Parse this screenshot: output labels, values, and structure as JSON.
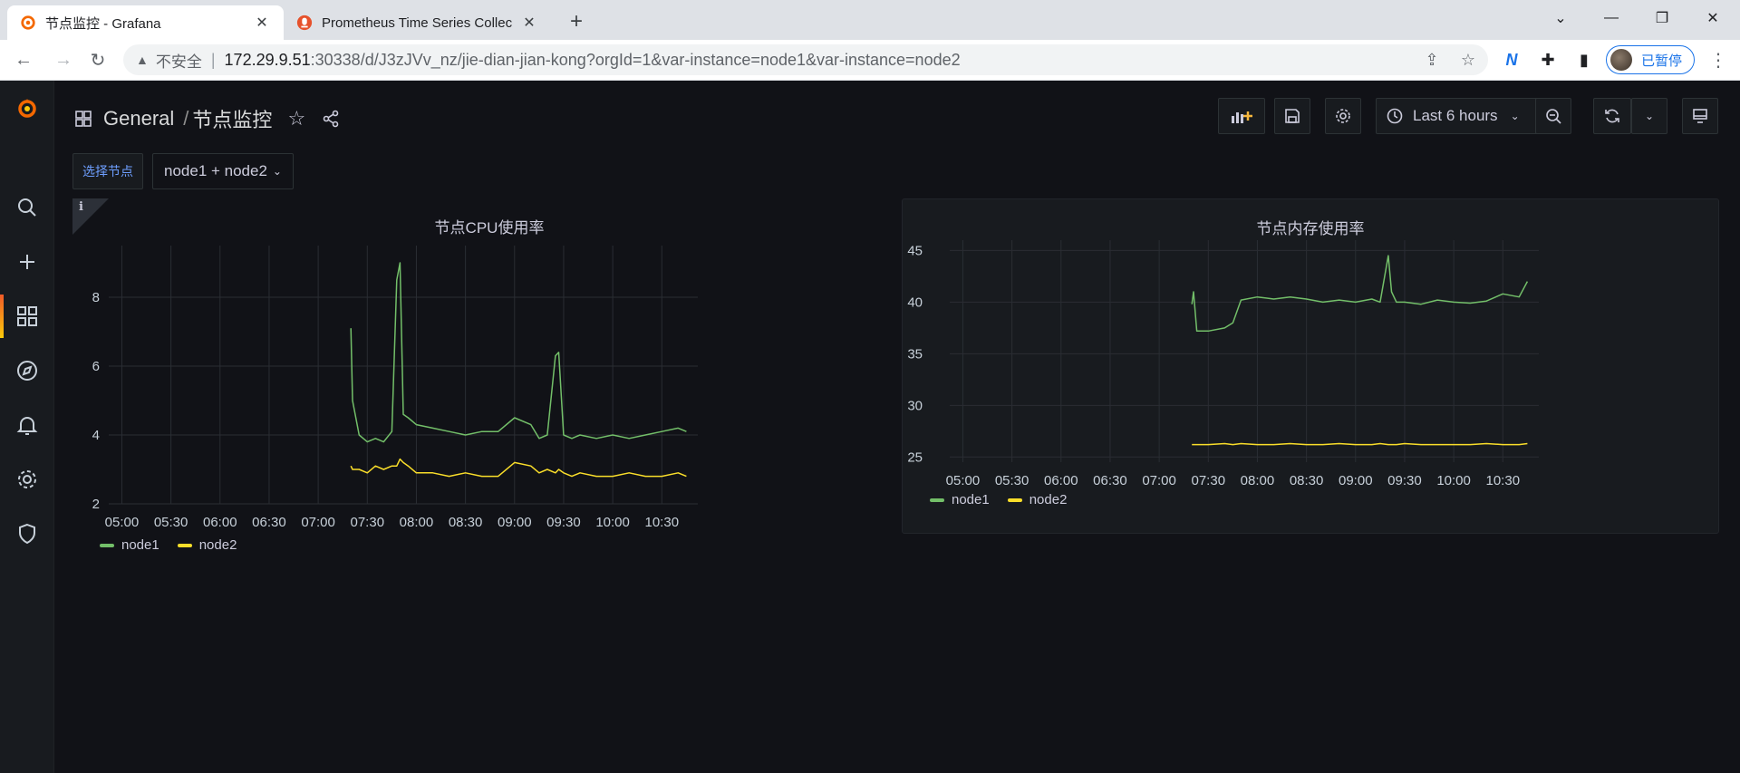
{
  "browser": {
    "tabs": [
      {
        "title": "节点监控 - Grafana",
        "active": true
      },
      {
        "title": "Prometheus Time Series Collec",
        "active": false
      }
    ],
    "address": {
      "insecure_label": "不安全",
      "host": "172.29.9.51",
      "path": ":30338/d/J3zJVv_nz/jie-dian-jian-kong?orgId=1&var-instance=node1&var-instance=node2"
    },
    "profile_label": "已暂停"
  },
  "dashboard": {
    "folder": "General",
    "title": "节点监控",
    "time_range": "Last 6 hours",
    "variable": {
      "label": "选择节点",
      "value": "node1 + node2"
    }
  },
  "colors": {
    "node1": "#73bf69",
    "node2": "#fade2a",
    "grid": "#2a2d33"
  },
  "chart_data": [
    {
      "type": "line",
      "title": "节点CPU使用率",
      "xlabel": "",
      "ylabel": "",
      "x_ticks": [
        "05:00",
        "05:30",
        "06:00",
        "06:30",
        "07:00",
        "07:30",
        "08:00",
        "08:30",
        "09:00",
        "09:30",
        "10:00",
        "10:30"
      ],
      "y_ticks": [
        "2",
        "4",
        "6",
        "8"
      ],
      "ylim": [
        2,
        9.5
      ],
      "x": [
        "07:20",
        "07:21",
        "07:25",
        "07:30",
        "07:35",
        "07:40",
        "07:45",
        "07:48",
        "07:50",
        "07:52",
        "07:55",
        "08:00",
        "08:10",
        "08:20",
        "08:30",
        "08:40",
        "08:50",
        "09:00",
        "09:10",
        "09:15",
        "09:20",
        "09:25",
        "09:27",
        "09:30",
        "09:35",
        "09:40",
        "09:50",
        "10:00",
        "10:10",
        "10:20",
        "10:30",
        "10:40",
        "10:45"
      ],
      "series": [
        {
          "name": "node1",
          "values": [
            7.1,
            5.0,
            4.0,
            3.8,
            3.9,
            3.8,
            4.1,
            8.5,
            9.0,
            4.6,
            4.5,
            4.3,
            4.2,
            4.1,
            4.0,
            4.1,
            4.1,
            4.5,
            4.3,
            3.9,
            4.0,
            6.3,
            6.4,
            4.0,
            3.9,
            4.0,
            3.9,
            4.0,
            3.9,
            4.0,
            4.1,
            4.2,
            4.1
          ]
        },
        {
          "name": "node2",
          "values": [
            3.1,
            3.0,
            3.0,
            2.9,
            3.1,
            3.0,
            3.1,
            3.1,
            3.3,
            3.2,
            3.1,
            2.9,
            2.9,
            2.8,
            2.9,
            2.8,
            2.8,
            3.2,
            3.1,
            2.9,
            3.0,
            2.9,
            3.0,
            2.9,
            2.8,
            2.9,
            2.8,
            2.8,
            2.9,
            2.8,
            2.8,
            2.9,
            2.8
          ]
        }
      ],
      "legend": [
        "node1",
        "node2"
      ]
    },
    {
      "type": "line",
      "title": "节点内存使用率",
      "xlabel": "",
      "ylabel": "",
      "x_ticks": [
        "05:00",
        "05:30",
        "06:00",
        "06:30",
        "07:00",
        "07:30",
        "08:00",
        "08:30",
        "09:00",
        "09:30",
        "10:00",
        "10:30"
      ],
      "y_ticks": [
        "25",
        "30",
        "35",
        "40",
        "45"
      ],
      "ylim": [
        24.5,
        46
      ],
      "x": [
        "07:20",
        "07:21",
        "07:23",
        "07:30",
        "07:40",
        "07:45",
        "07:50",
        "08:00",
        "08:10",
        "08:20",
        "08:30",
        "08:40",
        "08:50",
        "09:00",
        "09:10",
        "09:15",
        "09:20",
        "09:22",
        "09:25",
        "09:30",
        "09:40",
        "09:50",
        "10:00",
        "10:10",
        "10:20",
        "10:30",
        "10:40",
        "10:45"
      ],
      "series": [
        {
          "name": "node1",
          "values": [
            39.8,
            41.0,
            37.2,
            37.2,
            37.5,
            38.0,
            40.2,
            40.5,
            40.3,
            40.5,
            40.3,
            40.0,
            40.2,
            40.0,
            40.3,
            40.0,
            44.5,
            41.0,
            40.0,
            40.0,
            39.8,
            40.2,
            40.0,
            39.9,
            40.1,
            40.8,
            40.5,
            42.0
          ]
        },
        {
          "name": "node2",
          "values": [
            26.2,
            26.2,
            26.2,
            26.2,
            26.3,
            26.2,
            26.3,
            26.2,
            26.2,
            26.3,
            26.2,
            26.2,
            26.3,
            26.2,
            26.2,
            26.3,
            26.2,
            26.2,
            26.2,
            26.3,
            26.2,
            26.2,
            26.2,
            26.2,
            26.3,
            26.2,
            26.2,
            26.3
          ]
        }
      ],
      "legend": [
        "node1",
        "node2"
      ]
    }
  ]
}
